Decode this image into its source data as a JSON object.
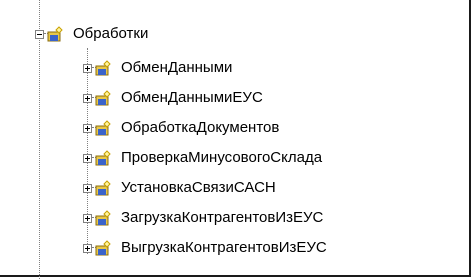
{
  "tree": {
    "root": {
      "label": "Обработки",
      "expanded": true
    },
    "items": [
      {
        "label": "ОбменДанными",
        "expanded": false
      },
      {
        "label": "ОбменДаннымиЕУС",
        "expanded": false
      },
      {
        "label": "ОбработкаДокументов",
        "expanded": false
      },
      {
        "label": "ПроверкаМинусовогоСклада",
        "expanded": false
      },
      {
        "label": "УстановкаСвязиСАСН",
        "expanded": false
      },
      {
        "label": "ЗагрузкаКонтрагентовИзЕУС",
        "expanded": false
      },
      {
        "label": "ВыгрузкаКонтрагентовИзЕУС",
        "expanded": false
      }
    ]
  },
  "colors": {
    "folder_yellow": "#e8c848",
    "folder_blue": "#3a63c9",
    "line_gray": "#808080"
  },
  "icons": {
    "expand": "plus-icon",
    "collapse": "minus-icon",
    "node": "processing-folder-icon"
  }
}
